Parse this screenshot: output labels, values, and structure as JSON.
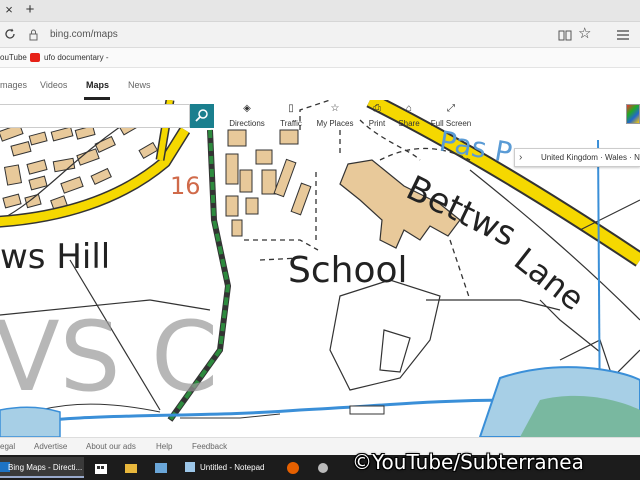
{
  "browser": {
    "tab_close_glyph": "×",
    "new_tab_glyph": "+",
    "url": "bing.com/maps"
  },
  "favorites": [
    {
      "label": "ouTube"
    },
    {
      "label": "ufo documentary -"
    }
  ],
  "nav": {
    "items": [
      {
        "label": "mages"
      },
      {
        "label": "Videos"
      },
      {
        "label": "Maps"
      },
      {
        "label": "News"
      }
    ]
  },
  "search": {
    "value": "",
    "placeholder": ""
  },
  "toolbar": [
    {
      "icon": "directions-icon",
      "label": "Directions"
    },
    {
      "icon": "traffic-icon",
      "label": "Traffic"
    },
    {
      "icon": "my-places-icon",
      "label": "My Places"
    },
    {
      "icon": "print-icon",
      "label": "Print"
    },
    {
      "icon": "share-icon",
      "label": "Share"
    },
    {
      "icon": "full-screen-icon",
      "label": "Full Screen"
    }
  ],
  "breadcrumb": {
    "text": "United Kingdom · Wales · N"
  },
  "map": {
    "labels": {
      "hill": "ws Hill",
      "school": "School",
      "bettws": "Bettws",
      "lane": "Lane",
      "pas": "Pas P",
      "large": "VS C",
      "number": "16"
    },
    "colors": {
      "road_yellow": "#f5d800",
      "building_tan": "#e8c99a",
      "path_green": "#2d8a3e",
      "water_blue": "#3a8fd8",
      "text_blue": "#5a9bd5"
    }
  },
  "footer": {
    "items": [
      {
        "label": "egal"
      },
      {
        "label": "Advertise"
      },
      {
        "label": "About our ads"
      },
      {
        "label": "Help"
      },
      {
        "label": "Feedback"
      }
    ]
  },
  "taskbar": {
    "items": [
      {
        "label": "Bing Maps - Directi..."
      },
      {
        "label": "Untitled - Notepad"
      }
    ]
  },
  "watermark": "©YouTube/Subterranea"
}
